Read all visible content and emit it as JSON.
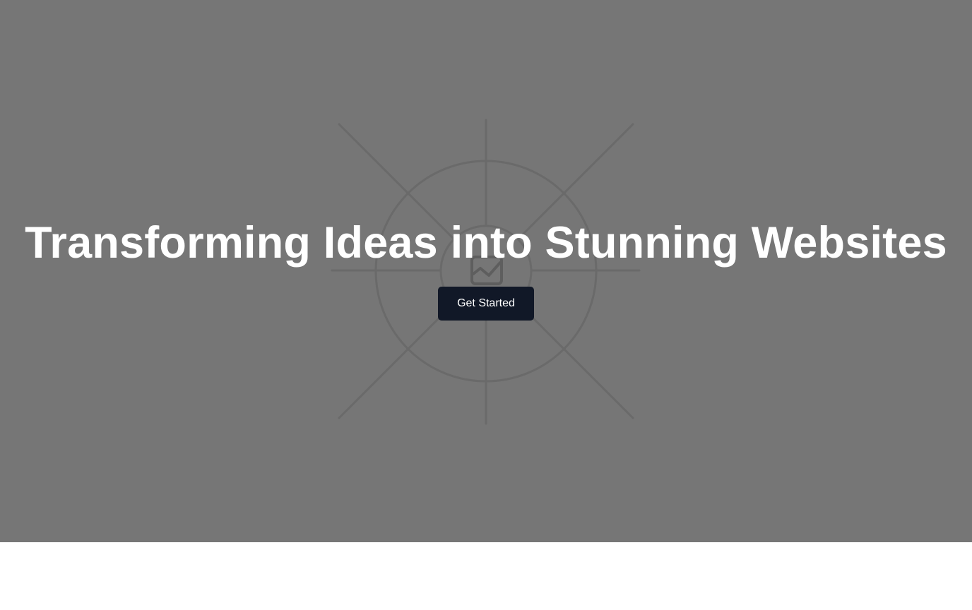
{
  "hero": {
    "title": "Transforming Ideas into Stunning Websites",
    "background_color": "#767676",
    "background_image_icon": "image-placeholder-icon"
  },
  "cta": {
    "label": "Get Started",
    "color": "#111827"
  }
}
